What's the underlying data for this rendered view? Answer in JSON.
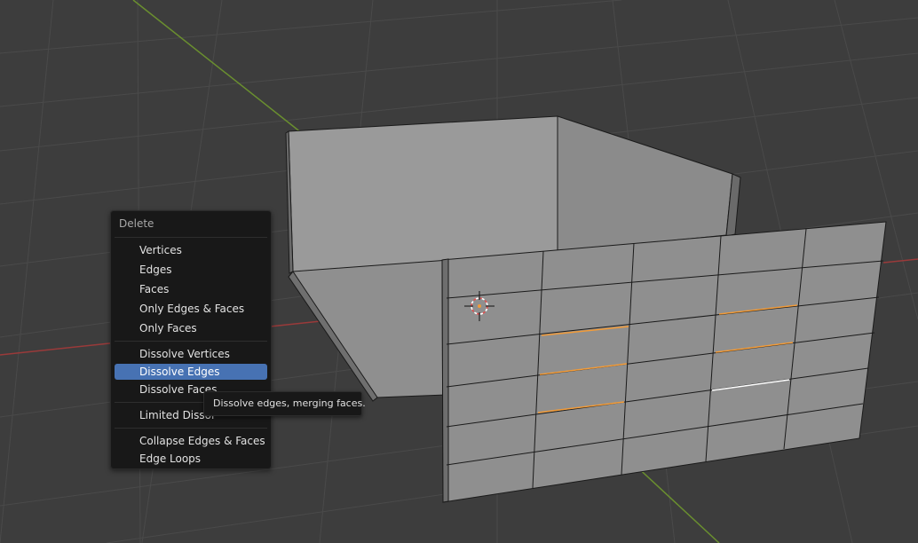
{
  "viewport": {
    "name": "3D Viewport",
    "colors": {
      "background": "#3d3d3d",
      "grid": "#4a4a4a",
      "x_axis": "#9a3a3a",
      "y_axis": "#6a8f2f",
      "mesh_face": "#8c8c8c",
      "mesh_edge": "#1a1a1a",
      "selected_edge": "#f29b38",
      "active_edge": "#ffffff"
    },
    "icons": [
      "3d-cursor-icon"
    ]
  },
  "context_menu": {
    "title": "Delete",
    "items": [
      {
        "label": "Vertices",
        "active": false
      },
      {
        "label": "Edges",
        "active": false
      },
      {
        "label": "Faces",
        "active": false
      },
      {
        "label": "Only Edges & Faces",
        "active": false
      },
      {
        "label": "Only Faces",
        "active": false
      },
      {
        "label": "Dissolve Vertices",
        "active": false
      },
      {
        "label": "Dissolve Edges",
        "active": true
      },
      {
        "label": "Dissolve Faces",
        "active": false
      },
      {
        "label": "Limited Dissol",
        "active": false
      },
      {
        "label": "Collapse Edges & Faces",
        "active": false
      },
      {
        "label": "Edge Loops",
        "active": false
      }
    ],
    "colors": {
      "highlight": "#4772b3",
      "background": "#181818"
    }
  },
  "tooltip": {
    "text": "Dissolve edges, merging faces."
  }
}
